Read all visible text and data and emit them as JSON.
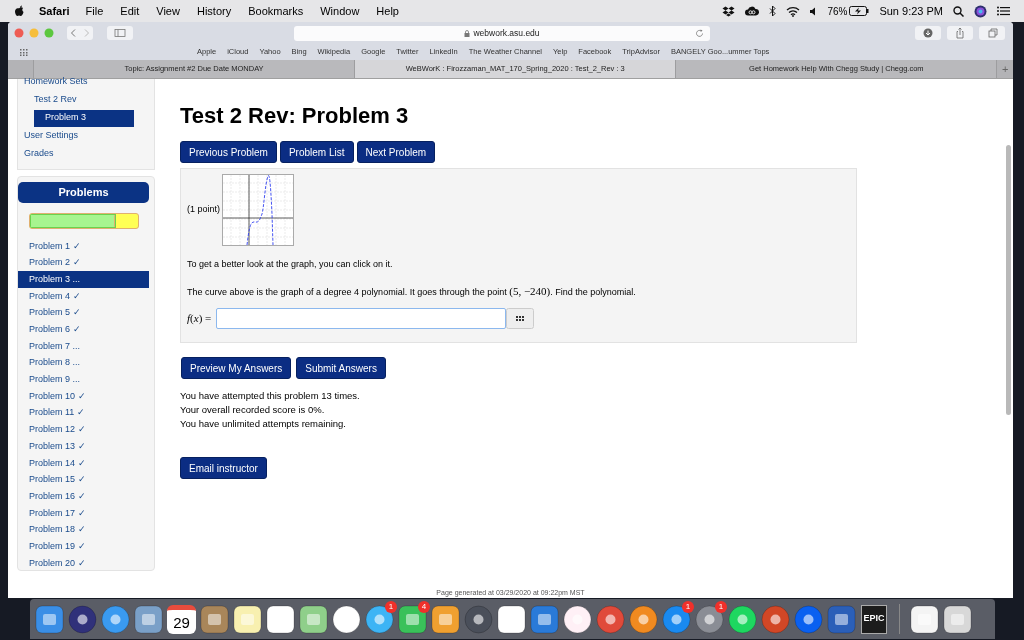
{
  "menu_bar": {
    "app": "Safari",
    "menus": [
      "File",
      "Edit",
      "View",
      "History",
      "Bookmarks",
      "Window",
      "Help"
    ],
    "battery": "76%",
    "clock": "Sun 9:23 PM"
  },
  "browser": {
    "url": "webwork.asu.edu",
    "bookmarks": [
      "Apple",
      "iCloud",
      "Yahoo",
      "Bing",
      "Wikipedia",
      "Google",
      "Twitter",
      "LinkedIn",
      "The Weather Channel",
      "Yelp",
      "Facebook",
      "TripAdvisor",
      "BANGELY Goo...ummer Tops"
    ],
    "tabs": [
      {
        "title": "Topic: Assignment #2 Due Date MONDAY",
        "selected": false
      },
      {
        "title": "WeBWorK : Firozzaman_MAT_170_Spring_2020 : Test_2_Rev : 3",
        "selected": true
      },
      {
        "title": "Get Homework Help With Chegg Study | Chegg.com",
        "selected": false
      }
    ],
    "new_tab": "+"
  },
  "sidebar": {
    "nav": [
      {
        "label": "Homework Sets",
        "selected": false,
        "children": [
          {
            "label": "Test 2 Rev",
            "selected": false,
            "children": [
              {
                "label": "Problem 3",
                "selected": true
              }
            ]
          }
        ]
      },
      {
        "label": "User Settings",
        "selected": false
      },
      {
        "label": "Grades",
        "selected": false
      }
    ],
    "problems_panel": {
      "title": "Problems",
      "progress": {
        "level": 0.8
      },
      "items": [
        {
          "label": "Problem 1 ✓",
          "selected": false
        },
        {
          "label": "Problem 2 ✓",
          "selected": false
        },
        {
          "label": "Problem 3 ...",
          "selected": true
        },
        {
          "label": "Problem 4 ✓",
          "selected": false
        },
        {
          "label": "Problem 5 ✓",
          "selected": false
        },
        {
          "label": "Problem 6 ✓",
          "selected": false
        },
        {
          "label": "Problem 7 ...",
          "selected": false
        },
        {
          "label": "Problem 8 ...",
          "selected": false
        },
        {
          "label": "Problem 9 ...",
          "selected": false
        },
        {
          "label": "Problem 10 ✓",
          "selected": false
        },
        {
          "label": "Problem 11 ✓",
          "selected": false
        },
        {
          "label": "Problem 12 ✓",
          "selected": false
        },
        {
          "label": "Problem 13 ✓",
          "selected": false
        },
        {
          "label": "Problem 14 ✓",
          "selected": false
        },
        {
          "label": "Problem 15 ✓",
          "selected": false
        },
        {
          "label": "Problem 16 ✓",
          "selected": false
        },
        {
          "label": "Problem 17 ✓",
          "selected": false
        },
        {
          "label": "Problem 18 ✓",
          "selected": false
        },
        {
          "label": "Problem 19 ✓",
          "selected": false
        },
        {
          "label": "Problem 20 ✓",
          "selected": false
        }
      ]
    }
  },
  "main": {
    "title": "Test 2 Rev: Problem 3",
    "nav_buttons": [
      "Previous Problem",
      "Problem List",
      "Next Problem"
    ],
    "problem": {
      "points": "(1 point)",
      "hint": "To get a better look at the graph, you can click on it.",
      "statement_before": "The curve above is the graph of a degree 4 polynomial. It goes through the point ",
      "point": "(5, −240)",
      "statement_after": ". Find the polynomial.",
      "answer_label": "*f*(*x*) ="
    },
    "action_buttons": [
      "Preview My Answers",
      "Submit Answers"
    ],
    "messages": [
      "You have attempted this problem 13 times.",
      "Your overall recorded score is 0%.",
      "You have unlimited attempts remaining."
    ],
    "email_button": "Email instructor",
    "footer": "Page generated at 03/29/2020 at 09:22pm MST"
  },
  "dock": {
    "calendar_day": "29",
    "epic_label": "EPIC",
    "badges": [
      "1",
      "4",
      "1",
      "1"
    ]
  }
}
